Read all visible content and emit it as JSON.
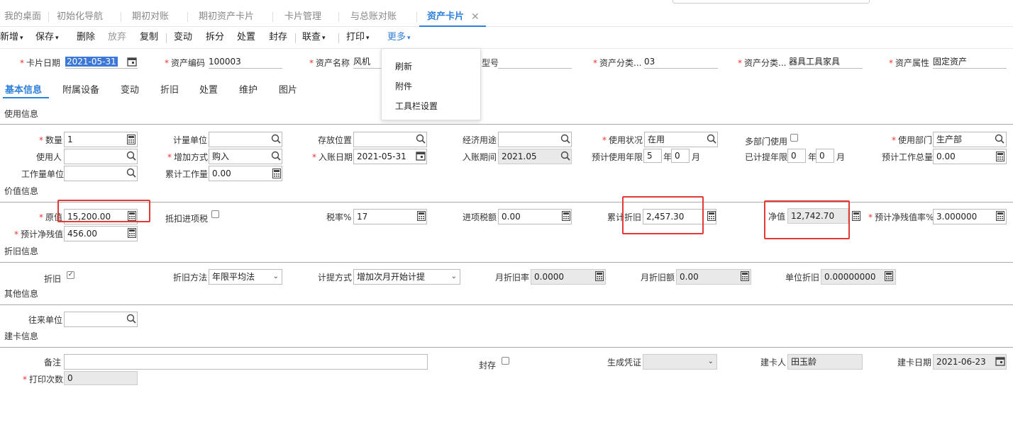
{
  "tabs": [
    "我的桌面",
    "初始化导航",
    "期初对账",
    "期初资产卡片",
    "卡片管理",
    "与总账对账",
    "资产卡片"
  ],
  "toolbar": {
    "add": "新增",
    "save": "保存",
    "delete": "删除",
    "abandon": "放弃",
    "copy": "复制",
    "change": "变动",
    "split": "拆分",
    "dispose": "处置",
    "seal": "封存",
    "link": "联查",
    "print": "打印",
    "more": "更多"
  },
  "more_menu": [
    "刷新",
    "附件",
    "工具栏设置"
  ],
  "header": {
    "card_date_label": "卡片日期",
    "card_date": "2021-05-31",
    "asset_code_label": "资产编码",
    "asset_code": "100003",
    "asset_name_label": "资产名称",
    "asset_name": "风机",
    "model_label": "型号",
    "model": "",
    "category_code_label": "资产分类...",
    "category_code": "03",
    "category_name_label": "资产分类...",
    "category_name": "器具工具家具",
    "attribute_label": "资产属性",
    "attribute": "固定资产"
  },
  "subtabs": [
    "基本信息",
    "附属设备",
    "变动",
    "折旧",
    "处置",
    "维护",
    "图片"
  ],
  "usage": {
    "section": "使用信息",
    "qty_label": "数量",
    "qty": "1",
    "unit_label": "计量单位",
    "unit": "",
    "location_label": "存放位置",
    "location": "",
    "purpose_label": "经济用途",
    "purpose": "",
    "status_label": "使用状况",
    "status": "在用",
    "multi_dept_label": "多部门使用",
    "dept_label": "使用部门",
    "dept": "生产部",
    "user_label": "使用人",
    "user": "",
    "add_method_label": "增加方式",
    "add_method": "购入",
    "entry_date_label": "入账日期",
    "entry_date": "2021-05-31",
    "entry_period_label": "入账期间",
    "entry_period": "2021.05",
    "expected_life_label": "预计使用年限",
    "expected_years": "5",
    "expected_months": "0",
    "year_unit": "年",
    "month_unit": "月",
    "accrued_life_label": "已计提年限",
    "accrued_years": "0",
    "accrued_months": "0",
    "total_work_label": "预计工作总量",
    "total_work": "0.00",
    "work_unit_label": "工作量单位",
    "work_unit": "",
    "cum_work_label": "累计工作量",
    "cum_work": "0.00"
  },
  "value": {
    "section": "价值信息",
    "orig_label": "原值",
    "orig": "15,200.00",
    "deduct_tax_label": "抵扣进项税",
    "tax_rate_label": "税率%",
    "tax_rate": "17",
    "input_tax_label": "进项税额",
    "input_tax": "0.00",
    "accum_dep_label": "累计折旧",
    "accum_dep": "2,457.30",
    "net_label": "净值",
    "net": "12,742.70",
    "residual_rate_label": "预计净残值率%",
    "residual_rate": "3.000000",
    "residual_label": "预计净残值",
    "residual": "456.00"
  },
  "depreciation": {
    "section": "折旧信息",
    "dep_label": "折旧",
    "method_label": "折旧方法",
    "method": "年限平均法",
    "calc_label": "计提方式",
    "calc": "增加次月开始计提",
    "month_rate_label": "月折旧率",
    "month_rate": "0.0000",
    "month_amount_label": "月折旧额",
    "month_amount": "0.00",
    "unit_dep_label": "单位折旧",
    "unit_dep": "0.00000000"
  },
  "other": {
    "section": "其他信息",
    "partner_label": "往来单位",
    "partner": ""
  },
  "build": {
    "section": "建卡信息",
    "remark_label": "备注",
    "remark": "",
    "sealed_label": "封存",
    "voucher_label": "生成凭证",
    "voucher": "",
    "creator_label": "建卡人",
    "creator": "田玉龄",
    "create_date_label": "建卡日期",
    "create_date": "2021-06-23",
    "print_count_label": "打印次数",
    "print_count": "0"
  }
}
